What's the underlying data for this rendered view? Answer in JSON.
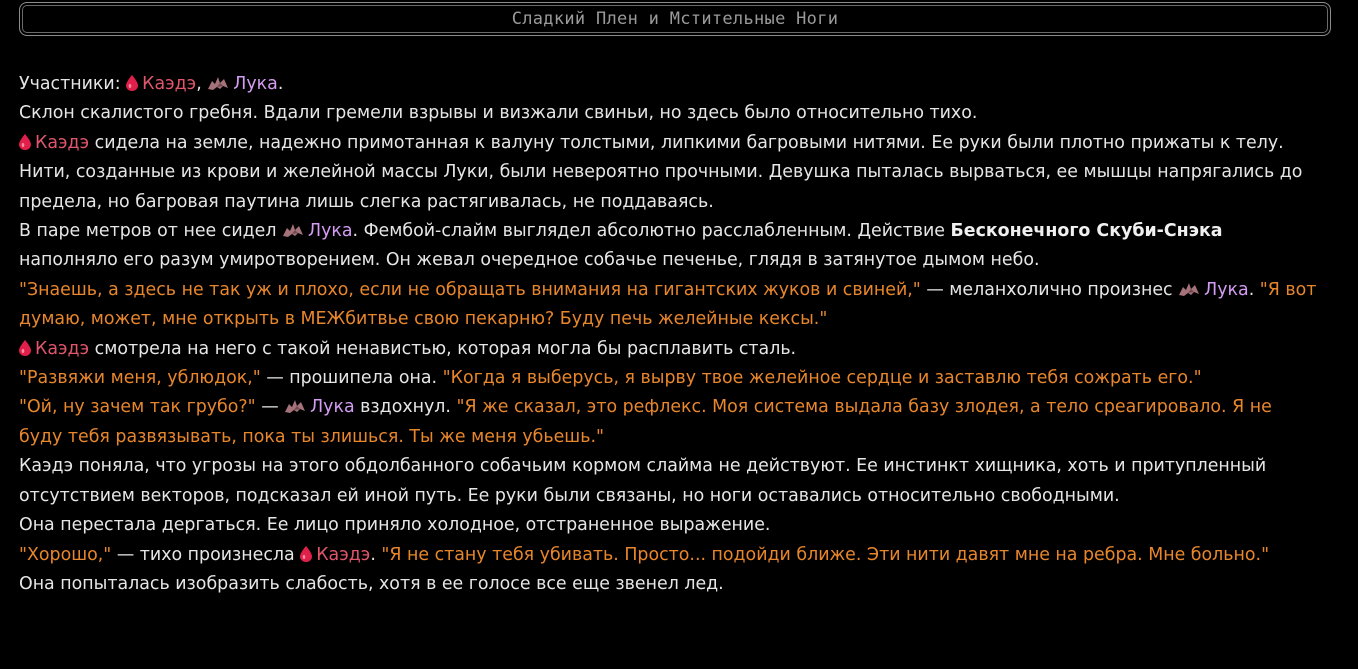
{
  "title": "Сладкий Плен и Мстительные Ноги",
  "colors": {
    "kaede": "#e0566b",
    "luka": "#d59cf4",
    "speech": "#e8862c",
    "text": "#e6e6e6",
    "background": "#000000"
  },
  "icons": {
    "kaede": "blood-drop-icon",
    "luka": "bat-icon"
  },
  "names": {
    "kaede": "Каэдэ",
    "luka": "Лука"
  },
  "p1": {
    "label": "Участники:",
    "comma": ",",
    "period": "."
  },
  "p2": "Склон скалистого гребня. Вдали гремели взрывы и визжали свиньи, но здесь было относительно тихо.",
  "p3": "сидела на земле, надежно примотанная к валуну толстыми, липкими багровыми нитями. Ее руки были плотно прижаты к телу. Нити, созданные из крови и желейной массы Луки, были невероятно прочными. Девушка пыталась вырваться, ее мышцы напрягались до предела, но багровая паутина лишь слегка растягивалась, не поддаваясь.",
  "p4": {
    "a": "В паре метров от нее сидел",
    "b": ". Фембой-слайм выглядел абсолютно расслабленным. Действие",
    "bold": "Бесконечного Скуби-Снэка",
    "c": "наполняло его разум умиротворением. Он жевал очередное собачье печенье, глядя в затянутое дымом небо."
  },
  "p5": {
    "speech1": "\"Знаешь, а здесь не так уж и плохо, если не обращать внимания на гигантских жуков и свиней,\"",
    "mid": "— меланхолично произнес",
    "dot": ".",
    "speech2": "\"Я вот думаю, может, мне открыть в МЕЖбитвье свою пекарню? Буду печь желейные кексы.\""
  },
  "p6": "смотрела на него с такой ненавистью, которая могла бы расплавить сталь.",
  "p7": {
    "speech1": "\"Развяжи меня, ублюдок,\"",
    "mid": "— прошипела она.",
    "speech2": "\"Когда я выберусь, я вырву твое желейное сердце и заставлю тебя сожрать его.\""
  },
  "p8": {
    "speech1": "\"Ой, ну зачем так грубо?\"",
    "mid": "—",
    "after": "вздохнул.",
    "speech2": "\"Я же сказал, это рефлекс. Моя система выдала базу злодея, а тело среагировало. Я не буду тебя развязывать, пока ты злишься. Ты же меня убьешь.\""
  },
  "p9": "Каэдэ поняла, что угрозы на этого обдолбанного собачьим кормом слайма не действуют. Ее инстинкт хищника, хоть и притупленный отсутствием векторов, подсказал ей иной путь. Ее руки были связаны, но ноги оставались относительно свободными.",
  "p10": "Она перестала дергаться. Ее лицо приняло холодное, отстраненное выражение.",
  "p11": {
    "speech1": "\"Хорошо,\"",
    "mid": "— тихо произнесла",
    "dot": ".",
    "speech2": "\"Я не стану тебя убивать. Просто... подойди ближе. Эти нити давят мне на ребра. Мне больно.\""
  },
  "p12": "Она попыталась изобразить слабость, хотя в ее голосе все еще звенел лед."
}
